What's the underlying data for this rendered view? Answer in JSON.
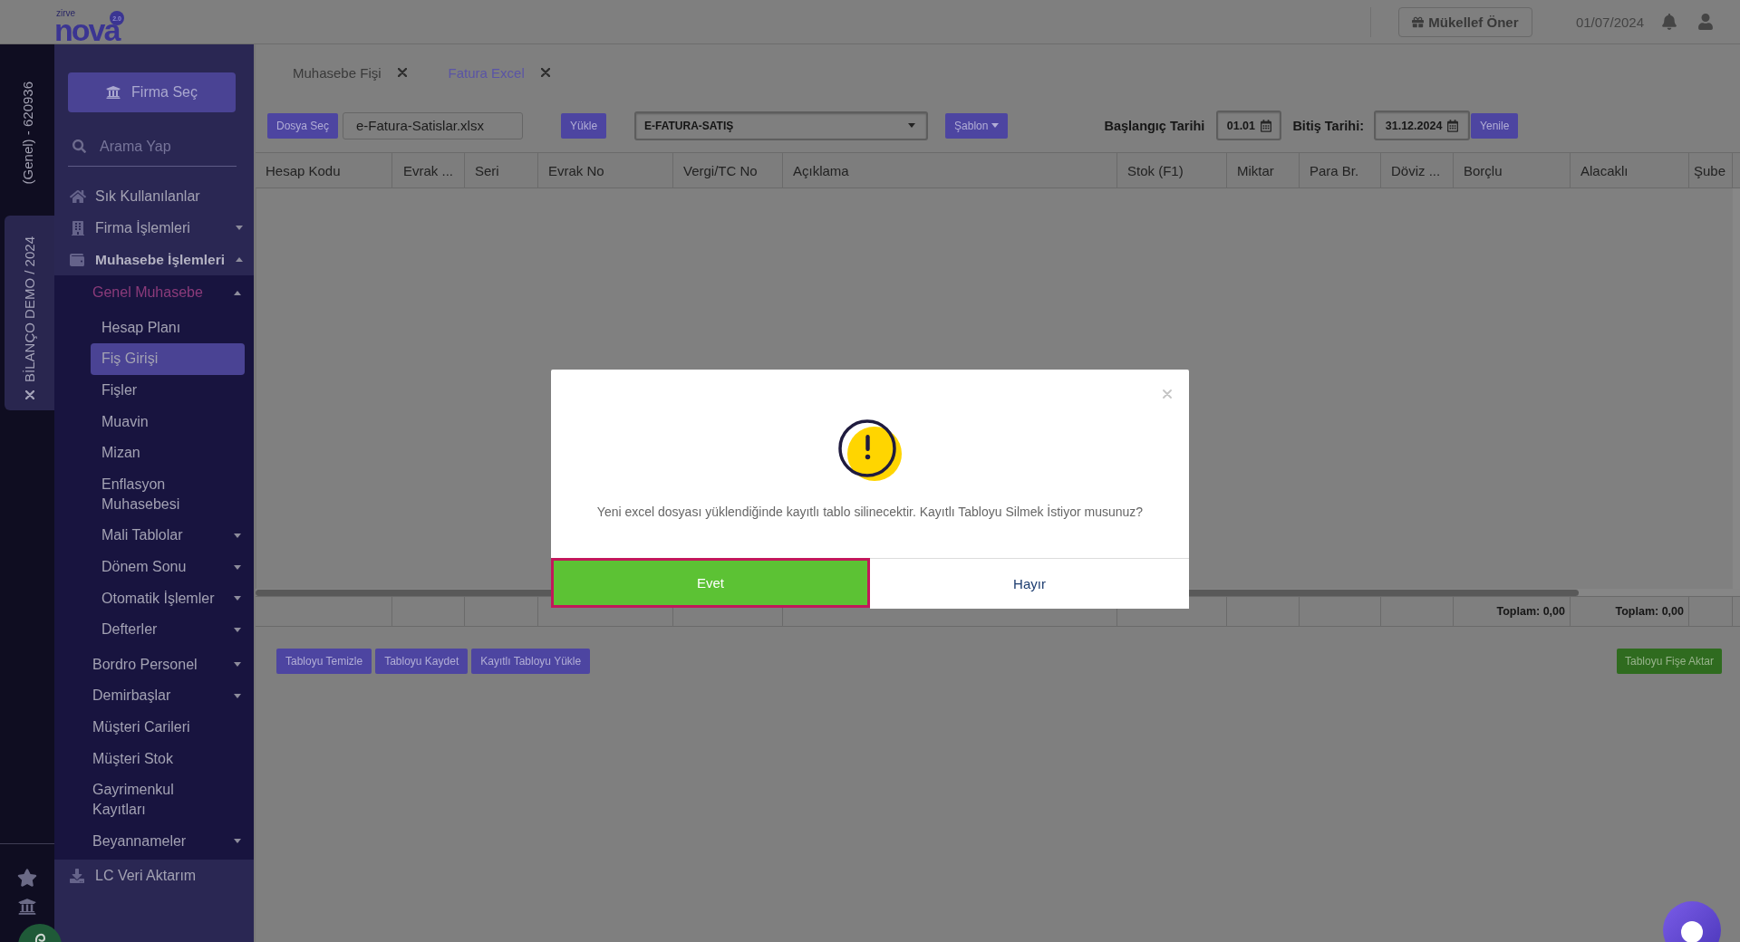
{
  "topbar": {
    "logo": {
      "prefix": "zirve",
      "name": "nova",
      "version": "2.0"
    },
    "recommend_button": "Mükellef Öner",
    "date": "01/07/2024"
  },
  "left_rail": {
    "company_code": "(Genel) - 620936",
    "period_tab": "BİLANÇO DEMO / 2024"
  },
  "sidebar": {
    "firm_button": "Firma Seç",
    "search": {
      "placeholder": "Arama Yap"
    },
    "menu": [
      {
        "label": "Sık Kullanılanlar",
        "selected": false
      },
      {
        "label": "Firma İşlemleri",
        "selected": false,
        "expanded": false
      },
      {
        "label": "Muhasebe İşlemleri",
        "selected": false,
        "expanded": true,
        "children": [
          {
            "label": "Genel Muhasebe",
            "selected": false,
            "expanded": true,
            "children": [
              {
                "label": "Hesap Planı",
                "selected": false
              },
              {
                "label": "Fiş Girişi",
                "selected": true
              },
              {
                "label": "Fişler",
                "selected": false
              },
              {
                "label": "Muavin",
                "selected": false
              },
              {
                "label": "Mizan",
                "selected": false
              },
              {
                "label": "Enflasyon Muhasebesi",
                "selected": false
              },
              {
                "label": "Mali Tablolar",
                "selected": false,
                "expanded": false
              },
              {
                "label": "Dönem Sonu",
                "selected": false,
                "expanded": false
              },
              {
                "label": "Otomatik İşlemler",
                "selected": false,
                "expanded": false
              },
              {
                "label": "Defterler",
                "selected": false,
                "expanded": false
              }
            ]
          },
          {
            "label": "Bordro Personel",
            "selected": false,
            "expanded": false
          },
          {
            "label": "Demirbaşlar",
            "selected": false,
            "expanded": false
          },
          {
            "label": "Müşteri Carileri",
            "selected": false
          },
          {
            "label": "Müşteri Stok",
            "selected": false
          },
          {
            "label": "Gayrimenkul Kayıtları",
            "selected": false
          },
          {
            "label": "Beyannameler",
            "selected": false,
            "expanded": false
          }
        ]
      },
      {
        "label": "LC Veri Aktarım",
        "selected": false
      }
    ]
  },
  "tabs": [
    {
      "label": "Muhasebe Fişi",
      "selected": false
    },
    {
      "label": "Fatura Excel",
      "selected": true
    }
  ],
  "toolbar": {
    "file_button": "Dosya Seç",
    "file_name": "e-Fatura-Satislar.xlsx",
    "upload_button": "Yükle",
    "template_select": "E-FATURA-SATIŞ",
    "template_button": "Şablon",
    "start_date": {
      "label": "Başlangıç Tarihi",
      "value": "01.01"
    },
    "end_date": {
      "label": "Bitiş Tarihi:",
      "value": "31.12.2024"
    },
    "refresh_button": "Yenile"
  },
  "table": {
    "columns": [
      {
        "label": "Hesap Kodu"
      },
      {
        "label": "Evrak ..."
      },
      {
        "label": "Seri"
      },
      {
        "label": "Evrak No"
      },
      {
        "label": "Vergi/TC No"
      },
      {
        "label": "Açıklama"
      },
      {
        "label": "Stok (F1)"
      },
      {
        "label": "Miktar"
      },
      {
        "label": "Para Br."
      },
      {
        "label": "Döviz ..."
      },
      {
        "label": "Borçlu",
        "total": "Toplam: 0,00"
      },
      {
        "label": "Alacaklı",
        "total": "Toplam: 0,00"
      },
      {
        "label": "Şube"
      }
    ]
  },
  "table_actions": [
    "Tabloyu Temizle",
    "Tabloyu Kaydet",
    "Kayıtlı Tabloyu Yükle"
  ],
  "transfer_button": "Tabloyu Fişe Aktar",
  "dialog": {
    "message": "Yeni excel dosyası yüklendiğinde kayıtlı tablo silinecektir. Kayıtlı Tabloyu Silmek İstiyor musunuz?",
    "buttons": [
      {
        "label": "Evet",
        "kind": "confirm",
        "focused": true
      },
      {
        "label": "Hayır",
        "kind": "cancel",
        "focused": false
      }
    ]
  }
}
